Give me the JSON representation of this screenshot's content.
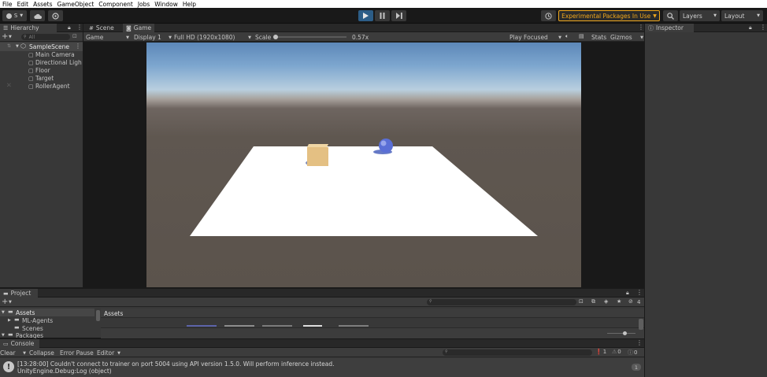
{
  "menu": [
    "File",
    "Edit",
    "Assets",
    "GameObject",
    "Component",
    "Jobs",
    "Window",
    "Help"
  ],
  "toolbar": {
    "account_label": "S",
    "experimental_label": "Experimental Packages In Use",
    "layers_label": "Layers",
    "layout_label": "Layout"
  },
  "hierarchy": {
    "tab_label": "Hierarchy",
    "search_placeholder": "All",
    "scene_name": "SampleScene",
    "items": [
      "Main Camera",
      "Directional Ligh",
      "Floor",
      "Target",
      "RollerAgent"
    ]
  },
  "game": {
    "tab_scene": "Scene",
    "tab_game": "Game",
    "view_mode": "Game",
    "display": "Display 1",
    "resolution": "Full HD (1920x1080)",
    "scale_label": "Scale",
    "scale_value": "0.57x",
    "scale_fraction": 0.0,
    "play_focused": "Play Focused",
    "stats": "Stats",
    "gizmos": "Gizmos"
  },
  "inspector": {
    "tab_label": "Inspector"
  },
  "project": {
    "tab_label": "Project",
    "tree": [
      {
        "label": "Assets",
        "level": 0,
        "expanded": true
      },
      {
        "label": "ML-Agents",
        "level": 1,
        "expanded": false
      },
      {
        "label": "Scenes",
        "level": 1,
        "expanded": false
      },
      {
        "label": "Packages",
        "level": 0,
        "expanded": true
      }
    ],
    "breadcrumb": "Assets",
    "hidden_count": "4"
  },
  "console": {
    "tab_label": "Console",
    "clear": "Clear",
    "collapse": "Collapse",
    "error_pause": "Error Pause",
    "editor": "Editor",
    "count_messages": "1",
    "count_warnings": "0",
    "count_errors": "0",
    "log_line1": "[13:28:00] Couldn't connect to trainer on port 5004 using API version 1.5.0. Will perform inference instead.",
    "log_line2": "UnityEngine.Debug:Log (object)",
    "log_count": "1"
  },
  "colors": {
    "accent_blue": "#2c5d87",
    "warning_orange": "#f0a71c",
    "floor": "#ffffff",
    "cube": "#e4c083",
    "sphere": "#5a6fd6"
  }
}
